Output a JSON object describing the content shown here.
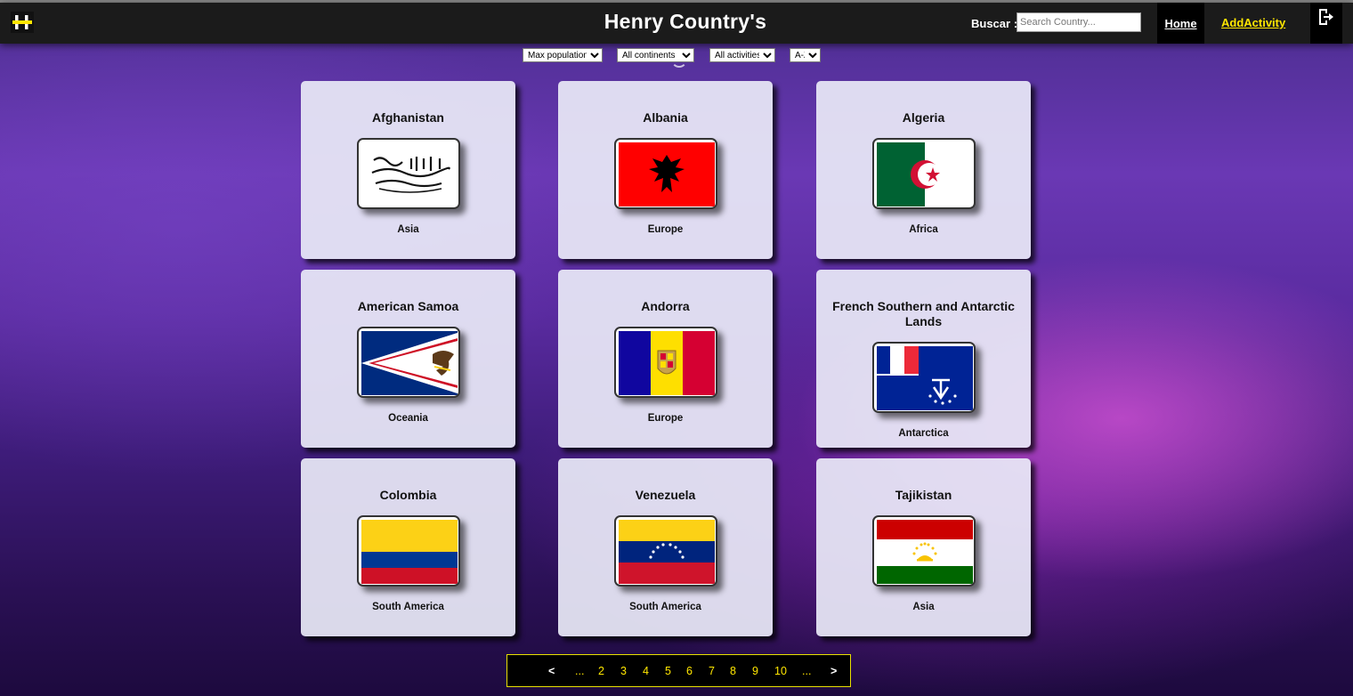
{
  "navbar": {
    "title": "Henry Country's",
    "search_label": "Buscar :",
    "search_placeholder": "Search Country...",
    "search_value": "",
    "home_label": "Home",
    "add_activity_label": "AddActivity"
  },
  "filters": {
    "population": "Max population",
    "continent": "All continents",
    "activity": "All activities",
    "order": "A-Z"
  },
  "countries": [
    {
      "name": "Afghanistan",
      "continent": "Asia",
      "flag": "afghanistan-flag"
    },
    {
      "name": "Albania",
      "continent": "Europe",
      "flag": "albania-flag"
    },
    {
      "name": "Algeria",
      "continent": "Africa",
      "flag": "algeria-flag"
    },
    {
      "name": "American Samoa",
      "continent": "Oceania",
      "flag": "american-samoa-flag"
    },
    {
      "name": "Andorra",
      "continent": "Europe",
      "flag": "andorra-flag"
    },
    {
      "name": "French Southern and Antarctic Lands",
      "continent": "Antarctica",
      "flag": "french-southern-lands-flag"
    },
    {
      "name": "Colombia",
      "continent": "South America",
      "flag": "colombia-flag"
    },
    {
      "name": "Venezuela",
      "continent": "South America",
      "flag": "venezuela-flag"
    },
    {
      "name": "Tajikistan",
      "continent": "Asia",
      "flag": "tajikistan-flag"
    }
  ],
  "pagination": {
    "prev": "<",
    "ellipsis_left": "...",
    "pages": [
      "2",
      "3",
      "4",
      "5",
      "6",
      "7",
      "8",
      "9",
      "10"
    ],
    "ellipsis_right": "...",
    "next": ">"
  },
  "colors": {
    "navbar_bg": "#1b1b1b",
    "accent_yellow": "#ffe600",
    "card_bg": "#e8e8f6"
  }
}
